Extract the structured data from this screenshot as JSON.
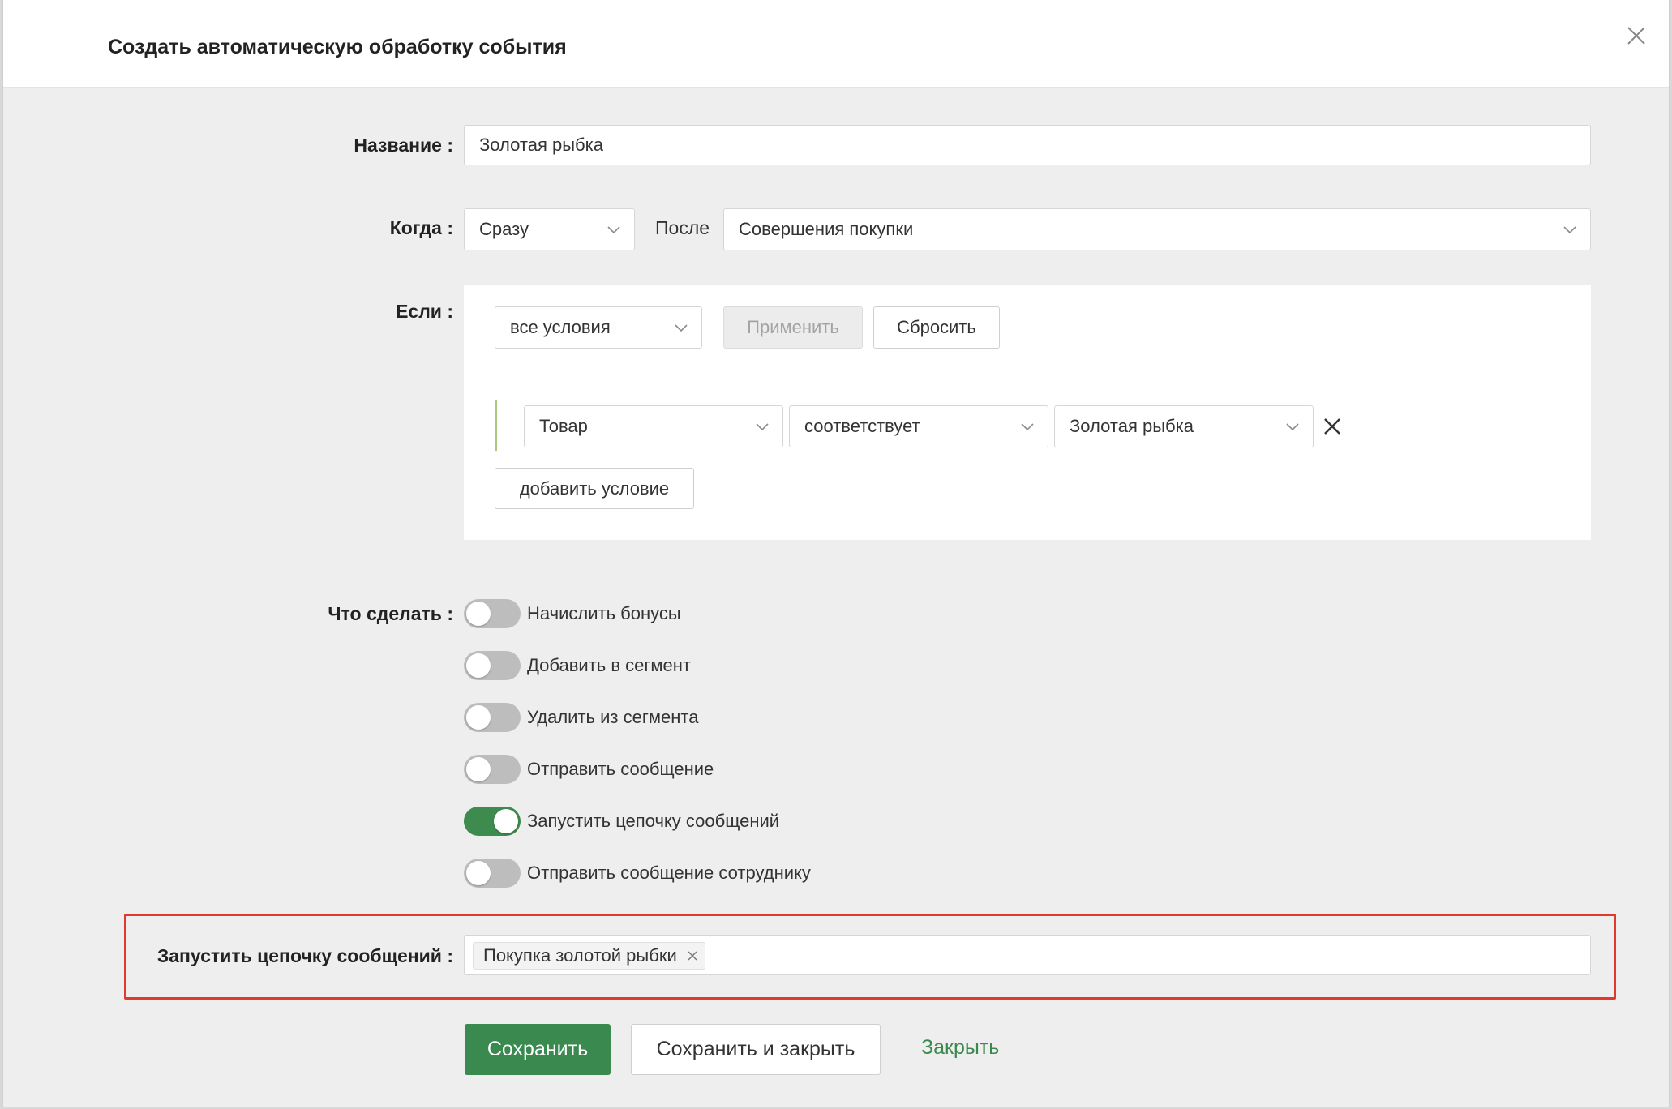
{
  "dialog": {
    "title": "Создать автоматическую обработку события"
  },
  "form": {
    "name": {
      "label": "Название :",
      "value": "Золотая рыбка"
    },
    "when": {
      "label": "Когда :",
      "timing": "Сразу",
      "after_label": "После",
      "event": "Совершения покупки"
    },
    "if": {
      "label": "Если :",
      "match_mode": "все условия",
      "apply_label": "Применить",
      "reset_label": "Сбросить",
      "condition": {
        "field": "Товар",
        "operator": "соответствует",
        "value": "Золотая рыбка"
      },
      "add_condition_label": "добавить условие"
    },
    "actions": {
      "label": "Что сделать :",
      "items": [
        {
          "label": "Начислить бонусы",
          "on": false
        },
        {
          "label": "Добавить в сегмент",
          "on": false
        },
        {
          "label": "Удалить из сегмента",
          "on": false
        },
        {
          "label": "Отправить сообщение",
          "on": false
        },
        {
          "label": "Запустить цепочку сообщений",
          "on": true
        },
        {
          "label": "Отправить сообщение сотруднику",
          "on": false
        }
      ]
    },
    "chain": {
      "label": "Запустить цепочку сообщений :",
      "selected": "Покупка золотой рыбки"
    }
  },
  "footer": {
    "save_label": "Сохранить",
    "save_close_label": "Сохранить и закрыть",
    "close_label": "Закрыть"
  },
  "colors": {
    "accent_green": "#3a8a4f",
    "highlight_red": "#e03a2c",
    "toggle_off": "#bdbdbd"
  },
  "icons": {
    "close": "close-icon",
    "chevron": "chevron-down-icon",
    "remove_condition": "remove-condition-icon",
    "tag_remove": "tag-remove-icon"
  }
}
